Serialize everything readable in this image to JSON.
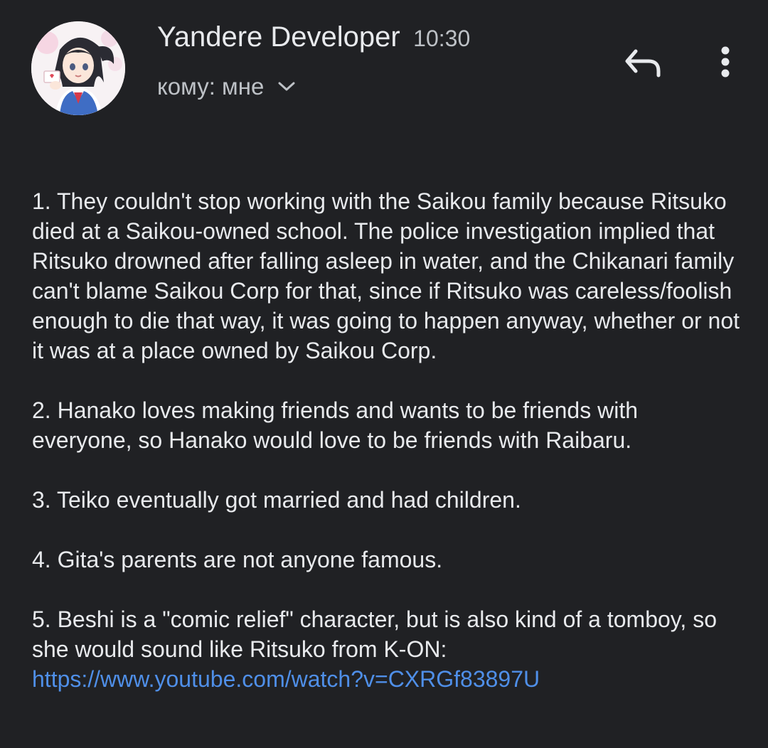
{
  "header": {
    "sender_name": "Yandere Developer",
    "time": "10:30",
    "recipient": "кому: мне",
    "avatar_icon": "anime-girl-avatar",
    "reply_icon": "reply-arrow-icon",
    "more_icon": "vertical-dots-icon"
  },
  "message": {
    "paragraphs": [
      "1. They couldn't stop working with the Saikou family because Ritsuko died at a Saikou-owned school. The police investigation implied that Ritsuko drowned after falling asleep in water, and the Chikanari family can't blame Saikou Corp for that, since if Ritsuko was careless/foolish enough to die that way, it was going to happen anyway, whether or not it was at a place owned by Saikou Corp.",
      "2. Hanako loves making friends and wants to be friends with everyone, so Hanako would love to be friends with Raibaru.",
      "3. Teiko eventually got married and had children.",
      "4. Gita's parents are not anyone famous.",
      "5. Beshi is a \"comic relief\" character, but is also kind of a tomboy, so she would sound like Ritsuko from K-ON:"
    ],
    "link": "https://www.youtube.com/watch?v=CXRGf83897U"
  },
  "colors": {
    "background": "#202124",
    "text_primary": "#e8eaed",
    "text_secondary": "#bdc1c6",
    "link": "#4f8fe8"
  }
}
